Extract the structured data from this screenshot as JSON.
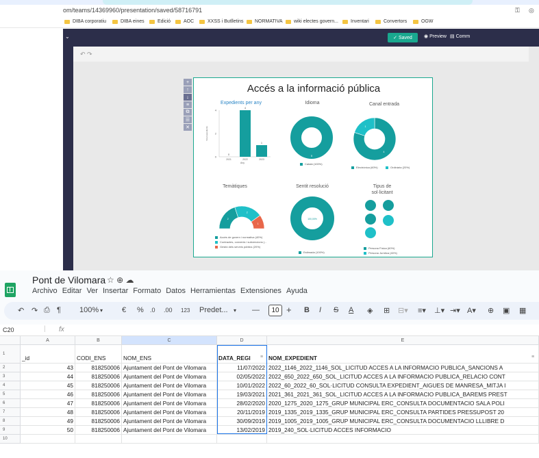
{
  "browser": {
    "url": "om/teams/14369960/presentation/saved/58716791",
    "bookmarks": [
      "DIBA corporatiu",
      "DIBA eines",
      "Edició",
      "AOC",
      "XXSS i Butlletins",
      "NORMATIVA",
      "wiki electes govern...",
      "Inventari",
      "Convertors",
      "OGW"
    ]
  },
  "editor": {
    "saved_label": "✓ Saved",
    "preview_label": "Preview",
    "comment_label": "Comm"
  },
  "infographic": {
    "title": "Accés a la informació pública",
    "panels": {
      "expedients": {
        "title": "Expedients per any",
        "ylabel": "Total expedients",
        "xlabel": "Any"
      },
      "idioma": {
        "title": "Idioma"
      },
      "canal": {
        "title": "Canal entrada"
      },
      "tematiques": {
        "title": "Temàtiques"
      },
      "sentit": {
        "title": "Sentit resolució",
        "center_label": "100,00%"
      },
      "tipus": {
        "title_line1": "Tipus de",
        "title_line2": "sol·licitant"
      }
    },
    "legends": {
      "idioma": [
        "Català (100%)"
      ],
      "canal": [
        "Electrònica (60%)",
        "Ordinària (20%)"
      ],
      "tematiques": [
        "Accés de govern i normativa (40%)",
        "Contractes, convenis i subvencions (...",
        "Gestió dels serveis públics (20%)"
      ],
      "sentit": [
        "Estimada (100%)"
      ],
      "tipus": [
        "Persona Física (60%)",
        "Persona Jurídica (40%)"
      ]
    },
    "colors": {
      "teal": "#159e9e",
      "cyan": "#1fc0c8",
      "orange": "#e8674a",
      "green": "#19a88f"
    }
  },
  "chart_data": [
    {
      "type": "bar",
      "title": "Expedients per any",
      "xlabel": "Any",
      "ylabel": "Total expedients",
      "categories": [
        "2021",
        "2022",
        "2023"
      ],
      "values": [
        0,
        4,
        1
      ],
      "ylim": [
        0,
        4
      ],
      "yticks": [
        "0",
        "2",
        "4"
      ]
    },
    {
      "type": "pie",
      "title": "Idioma",
      "labels": [
        "Català"
      ],
      "values": [
        100
      ],
      "slice_labels": [
        "5"
      ]
    },
    {
      "type": "pie",
      "title": "Canal entrada",
      "labels": [
        "Electrònica",
        "Ordinària"
      ],
      "values": [
        80,
        20
      ],
      "slice_labels": [
        "4",
        "1"
      ]
    },
    {
      "type": "pie",
      "title": "Temàtiques",
      "labels": [
        "Accés de govern i normativa",
        "Contractes, convenis i subvencions",
        "Gestió dels serveis públics"
      ],
      "values": [
        40,
        40,
        20
      ],
      "slice_labels": [
        "2",
        "2",
        "1"
      ]
    },
    {
      "type": "pie",
      "title": "Sentit resolució",
      "labels": [
        "Estimada"
      ],
      "values": [
        100
      ]
    },
    {
      "type": "pie",
      "title": "Tipus de sol·licitant",
      "labels": [
        "Persona Física",
        "Persona Jurídica"
      ],
      "values": [
        60,
        40
      ]
    }
  ],
  "sheets": {
    "title": "Pont de Vilomara",
    "title_icons": "☆ ⊕ ☁",
    "menus": [
      "Archivo",
      "Editar",
      "Ver",
      "Insertar",
      "Formato",
      "Datos",
      "Herramientas",
      "Extensiones",
      "Ayuda"
    ],
    "toolbar": {
      "undo": "↶",
      "redo": "↷",
      "print": "⎙",
      "paint": "¶",
      "zoom": "100%",
      "currency": "€",
      "percent": "%",
      "dec_minus": ".0",
      "dec_plus": ".00",
      "format123": "123",
      "font": "Predet...",
      "minus": "—",
      "fontsize": "10",
      "plus": "+",
      "bold": "B",
      "italic": "I",
      "strike": "S",
      "textcolor": "A"
    },
    "cellref": "C20",
    "fx": "fx",
    "columns": [
      "A",
      "B",
      "C",
      "D",
      "E"
    ],
    "row_numbers": [
      "1",
      "2",
      "3",
      "4",
      "5",
      "6",
      "7",
      "8",
      "9",
      "10"
    ],
    "headers": [
      "_id",
      "CODI_ENS",
      "NOM_ENS",
      "DATA_REGI",
      "NOM_EXPEDIENT"
    ],
    "rows": [
      [
        "43",
        "818250006",
        "Ajuntament del Pont de Vilomara",
        "11/07/2022",
        "2022_1146_2022_1146_SOL_LICITUD ACCES A LA INFORMACIO PUBLICA_SANCIONS A"
      ],
      [
        "44",
        "818250006",
        "Ajuntament del Pont de Vilomara",
        "02/05/2022",
        "2022_650_2022_650_SOL_LICITUD ACCES A LA INFORMACIO PUBLICA_RELACIO CONT"
      ],
      [
        "45",
        "818250006",
        "Ajuntament del Pont de Vilomara",
        "10/01/2022",
        "2022_60_2022_60_SOL·LICITUD CONSULTA EXPEDIENT_AIGUES DE MANRESA_MITJA I"
      ],
      [
        "46",
        "818250006",
        "Ajuntament del Pont de Vilomara",
        "19/03/2021",
        "2021_361_2021_361_SOL_LICITUD ACCES A LA INFORMACIO PUBLICA_BAREMS PREST"
      ],
      [
        "47",
        "818250006",
        "Ajuntament del Pont de Vilomara",
        "28/02/2020",
        "2020_1275_2020_1275_GRUP MUNICIPAL ERC_CONSULTA DOCUMENTACIO SALA POLI"
      ],
      [
        "48",
        "818250006",
        "Ajuntament del Pont de Vilomara",
        "20/11/2019",
        "2019_1335_2019_1335_GRUP MUNICIPAL ERC_CONSULTA PARTIDES PRESSUPOST 20"
      ],
      [
        "49",
        "818250006",
        "Ajuntament del Pont de Vilomara",
        "30/09/2019",
        "2019_1005_2019_1005_GRUP MUNICIPAL ERC_CONSULTA DOCUMENTACIO LLLIBRE D"
      ],
      [
        "50",
        "818250006",
        "Ajuntament del Pont de Vilomara",
        "13/02/2019",
        "2019_240_SOL·LICITUD ACCES INFORMACIO"
      ]
    ]
  }
}
